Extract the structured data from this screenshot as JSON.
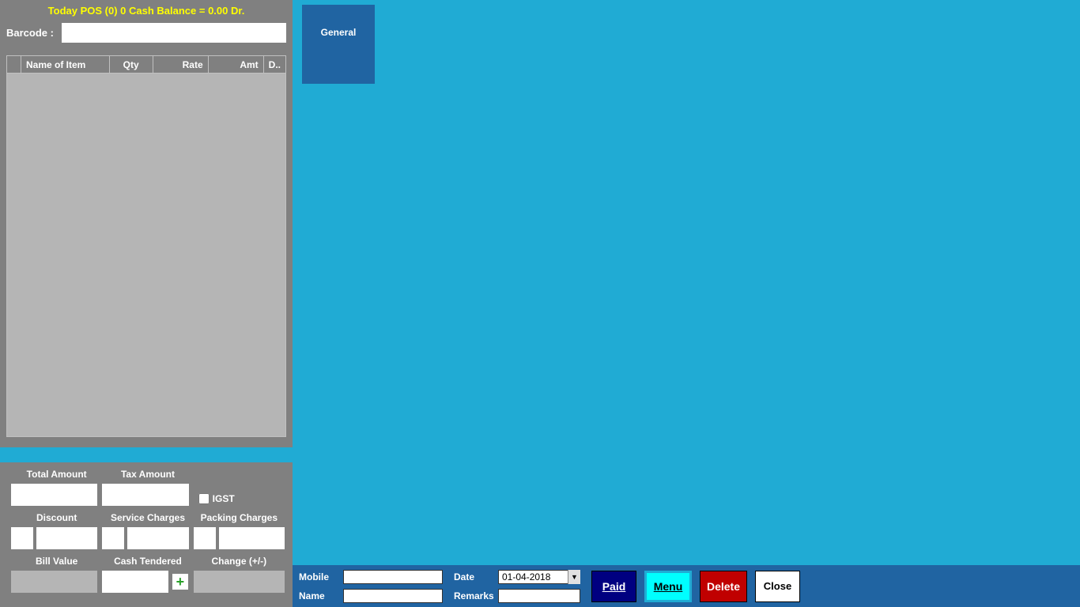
{
  "status": "Today POS (0) 0  Cash Balance = 0.00 Dr.",
  "barcode": {
    "label": "Barcode :",
    "value": ""
  },
  "grid": {
    "headers": [
      "",
      "Name of Item",
      "Qty",
      "Rate",
      "Amt",
      "D.."
    ]
  },
  "category": {
    "label": "General"
  },
  "totals": {
    "total_amount": {
      "label": "Total Amount",
      "value": ""
    },
    "tax_amount": {
      "label": "Tax Amount",
      "value": ""
    },
    "igst": {
      "label": "IGST",
      "checked": false
    },
    "discount": {
      "label": "Discount",
      "pct": "",
      "value": ""
    },
    "service": {
      "label": "Service Charges",
      "pct": "",
      "value": ""
    },
    "packing": {
      "label": "Packing Charges",
      "pct": "",
      "value": ""
    },
    "bill_value": {
      "label": "Bill Value",
      "value": ""
    },
    "cash_tendered": {
      "label": "Cash Tendered",
      "value": ""
    },
    "change": {
      "label": "Change (+/-)",
      "value": ""
    }
  },
  "footer": {
    "mobile": {
      "label": "Mobile",
      "value": ""
    },
    "name": {
      "label": "Name",
      "value": ""
    },
    "date": {
      "label": "Date",
      "value": "01-04-2018"
    },
    "remarks": {
      "label": "Remarks",
      "value": ""
    },
    "buttons": {
      "paid": "Paid",
      "menu": "Menu",
      "delete": "Delete",
      "close": "Close"
    }
  }
}
